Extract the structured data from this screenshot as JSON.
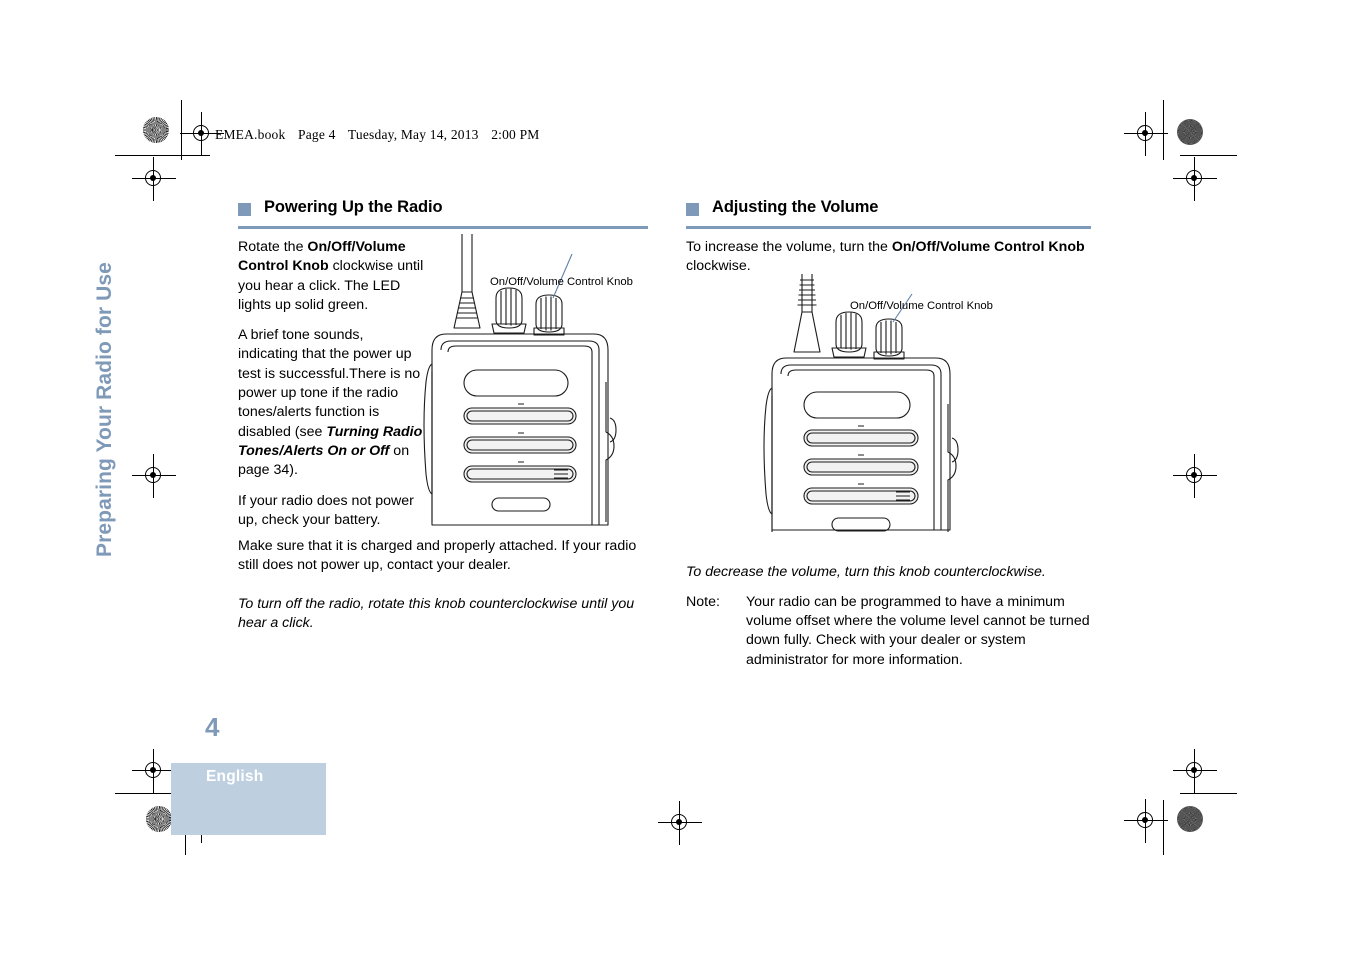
{
  "document": {
    "running_head": {
      "file": "EMEA.book",
      "page": "Page 4",
      "day": "Tuesday, May 14, 2013",
      "time": "2:00 PM"
    },
    "side_tab": "Preparing Your Radio for Use",
    "page_number": "4",
    "language": "English",
    "colors": {
      "accent": "#7f9ab8",
      "footer_block": "#bed0e0",
      "text": "#000000",
      "callout_line": "#5f7fa8"
    }
  },
  "left_column": {
    "heading": "Powering Up the Radio",
    "paragraphs": {
      "p1_pre": "Rotate the ",
      "p1_bold": "On/Off/Volume Control Knob",
      "p1_post": " clockwise until you hear a click. The LED lights up solid green.",
      "p2_pre": "A brief tone sounds, indicating that the power up test is successful.There is no power up tone if the radio tones/alerts function is disabled (see ",
      "p2_bolditalic": "Turning Radio Tones/Alerts On or Off",
      "p2_post": " on page 34).",
      "p3_narrow": "If your radio does not power up, check your battery.",
      "p3_wide": "Make sure that it is charged and properly attached. If your radio still does not power up, contact your dealer.",
      "p4_italic": "To turn off the radio, rotate this knob counterclockwise until you hear a click."
    },
    "figure": {
      "callout": "On/Off/Volume Control Knob",
      "alt": "two-way radio front view with antenna and control knobs"
    }
  },
  "right_column": {
    "heading": "Adjusting the Volume",
    "paragraphs": {
      "p1_pre": "To increase the volume, turn the ",
      "p1_bold": "On/Off/Volume Control Knob",
      "p1_post": " clockwise.",
      "p2_italic": "To decrease the volume, turn this knob counterclockwise."
    },
    "note": {
      "label": "Note:",
      "text": "Your radio can be programmed to have a minimum volume offset where the volume level cannot be turned down fully. Check with your dealer or system administrator for more information."
    },
    "figure": {
      "callout": "On/Off/Volume Control Knob",
      "alt": "two-way radio front view with antenna and control knobs"
    }
  }
}
